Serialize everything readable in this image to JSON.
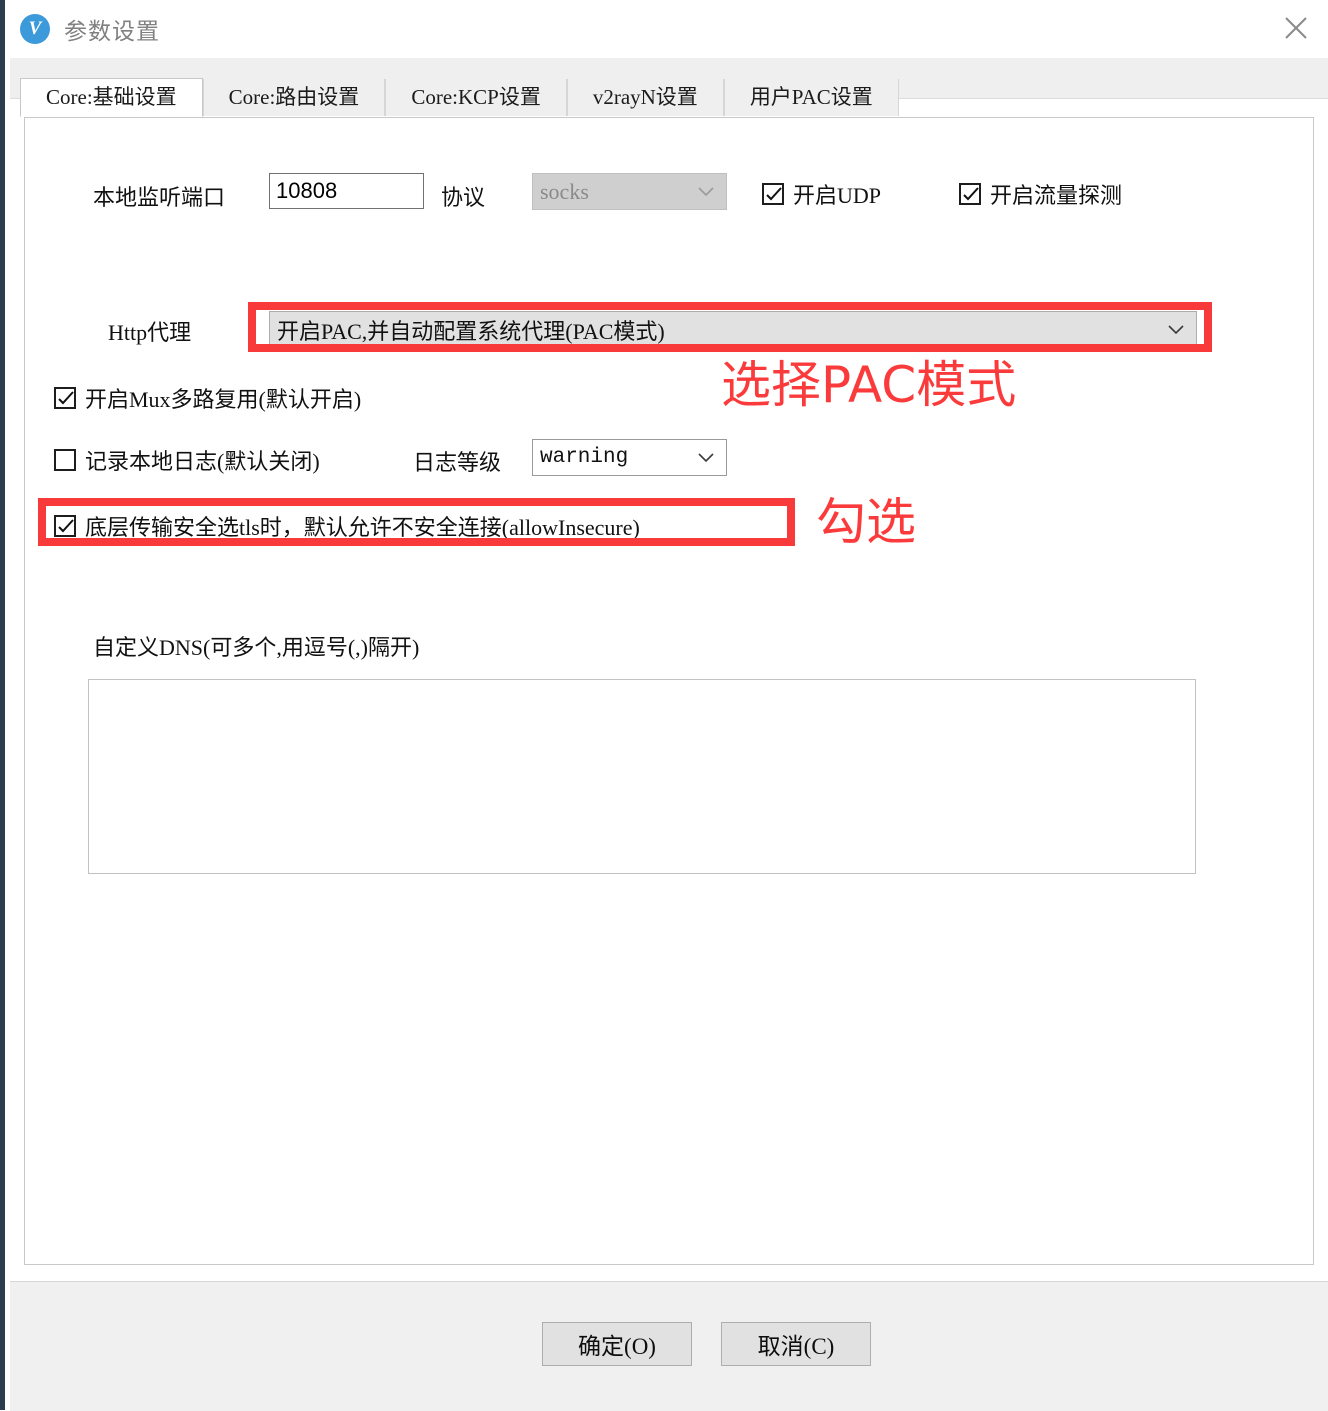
{
  "window": {
    "title": "参数设置",
    "logo_letter": "V",
    "close_label": "×"
  },
  "tabs": [
    {
      "label": "Core:基础设置",
      "active": true
    },
    {
      "label": "Core:路由设置",
      "active": false
    },
    {
      "label": "Core:KCP设置",
      "active": false
    },
    {
      "label": "v2rayN设置",
      "active": false
    },
    {
      "label": "用户PAC设置",
      "active": false
    }
  ],
  "form": {
    "local_port_label": "本地监听端口",
    "local_port_value": "10808",
    "protocol_label": "协议",
    "protocol_value": "socks",
    "udp_checkbox_label": "开启UDP",
    "udp_checked": true,
    "sniffing_checkbox_label": "开启流量探测",
    "sniffing_checked": true,
    "http_proxy_label": "Http代理",
    "http_proxy_value": "开启PAC,并自动配置系统代理(PAC模式)",
    "mux_checkbox_label": "开启Mux多路复用(默认开启)",
    "mux_checked": true,
    "log_checkbox_label": "记录本地日志(默认关闭)",
    "log_checked": false,
    "loglevel_label": "日志等级",
    "loglevel_value": "warning",
    "allow_insecure_label": "底层传输安全选tls时，默认允许不安全连接(allowInsecure)",
    "allow_insecure_checked": true,
    "dns_label": "自定义DNS(可多个,用逗号(,)隔开)",
    "dns_value": ""
  },
  "annotations": [
    {
      "text": "选择PAC模式"
    },
    {
      "text": "勾选"
    }
  ],
  "footer": {
    "ok_label": "确定(O)",
    "cancel_label": "取消(C)"
  },
  "colors": {
    "annotation_red": "#fb3b3b",
    "logo_blue": "#3d9ada",
    "title_grey": "#808080"
  }
}
